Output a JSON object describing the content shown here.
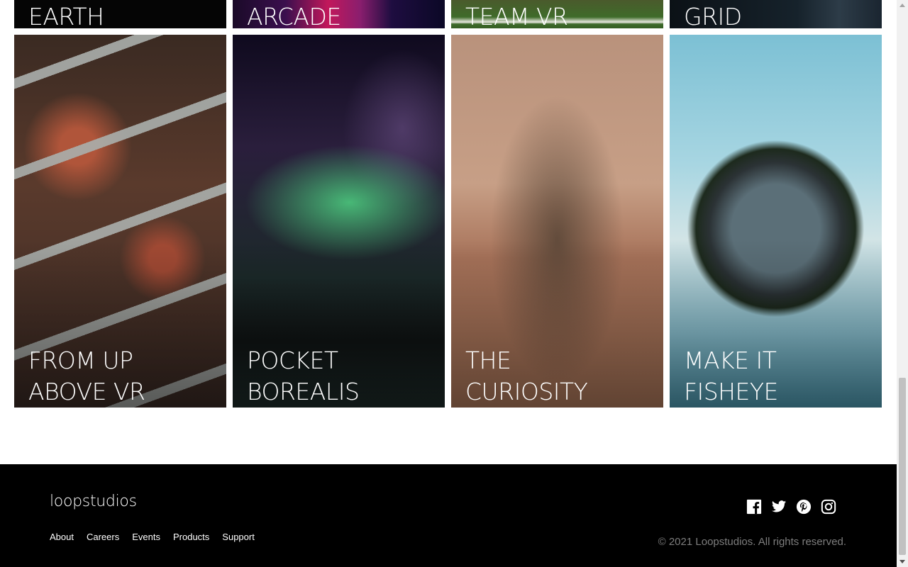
{
  "creations": {
    "top_row": [
      {
        "title": "EARTH"
      },
      {
        "title": "ARCADE"
      },
      {
        "title": "TEAM VR"
      },
      {
        "title": "GRID"
      }
    ],
    "bottom_row": [
      {
        "title": "FROM UP\nABOVE VR"
      },
      {
        "title": "POCKET\nBOREALIS"
      },
      {
        "title": "THE\nCURIOSITY"
      },
      {
        "title": "MAKE IT\nFISHEYE"
      }
    ]
  },
  "footer": {
    "logo": "loopstudios",
    "nav": [
      "About",
      "Careers",
      "Events",
      "Products",
      "Support"
    ],
    "social_icons": [
      "facebook-icon",
      "twitter-icon",
      "pinterest-icon",
      "instagram-icon"
    ],
    "copyright": "© 2021 Loopstudios. All rights reserved."
  },
  "colors": {
    "footer_bg": "#000000",
    "text_light": "#ffffff",
    "copyright_text": "#7d7d7d"
  }
}
